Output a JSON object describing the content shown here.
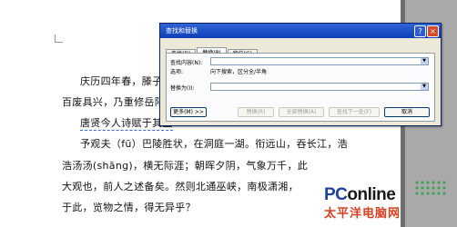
{
  "document": {
    "lines": [
      "庆历四年春，滕子京",
      "百废具兴，乃重修岳阳楼",
      "唐贤今人诗赋于其上",
      "予观夫（fū）巴陵胜状，在洞庭一湖。衔远山，吞长江，浩",
      "浩汤汤(shāng)，横无际涯；朝晖夕阴，气象万千，此",
      "大观也，前人之述备矣。然则北通巫峡，南极潇湘，",
      "于此，览物之情，得无异乎？"
    ]
  },
  "dialog": {
    "title": "查找和替换",
    "help_glyph": "?",
    "close_glyph": "×",
    "tabs": [
      {
        "label": "查找(D)",
        "active": false
      },
      {
        "label": "替换(P)",
        "active": true
      },
      {
        "label": "定位(G)",
        "active": false
      }
    ],
    "find_label": "查找内容(N):",
    "options_label": "选项:",
    "options_value": "向下搜索，区分全/半角",
    "replace_label": "替换为(I):",
    "buttons": {
      "more": "更多(M) >>",
      "replace": "替换(R)",
      "replace_all": "全部替换(A)",
      "find_next": "查找下一处(F)",
      "cancel": "取消"
    }
  },
  "watermark": {
    "brand_prefix": "PC",
    "brand_suffix": "online",
    "brand_cn": "太平洋电脑网"
  }
}
